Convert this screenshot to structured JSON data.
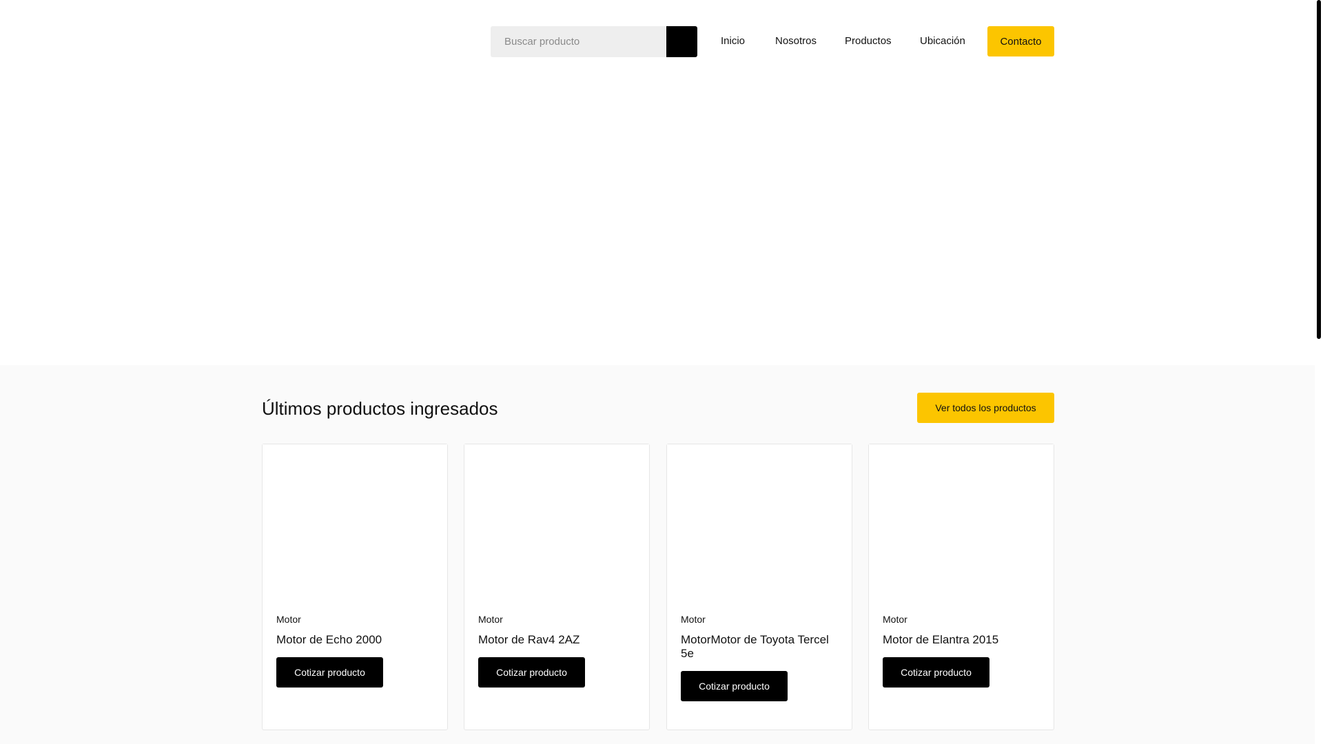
{
  "header": {
    "search": {
      "placeholder": "Buscar producto",
      "value": ""
    },
    "nav": [
      {
        "label": "Inicio"
      },
      {
        "label": "Nosotros"
      },
      {
        "label": "Productos"
      },
      {
        "label": "Ubicación"
      }
    ],
    "contact_label": "Contacto"
  },
  "products": {
    "title": "Últimos productos ingresados",
    "view_all_label": "Ver todos los productos",
    "items": [
      {
        "category": "Motor",
        "title": "Motor de Echo 2000",
        "button": "Cotizar producto"
      },
      {
        "category": "Motor",
        "title": "Motor de Rav4 2AZ",
        "button": "Cotizar producto"
      },
      {
        "category": "Motor",
        "title": "MotorMotor de Toyota Tercel 5e",
        "button": "Cotizar producto"
      },
      {
        "category": "Motor",
        "title": "Motor de Elantra 2015",
        "button": "Cotizar producto"
      }
    ]
  },
  "colors": {
    "accent": "#fcc500",
    "dark": "#000000",
    "section_bg": "#fafafa"
  },
  "icons": {
    "search": "search-icon"
  }
}
